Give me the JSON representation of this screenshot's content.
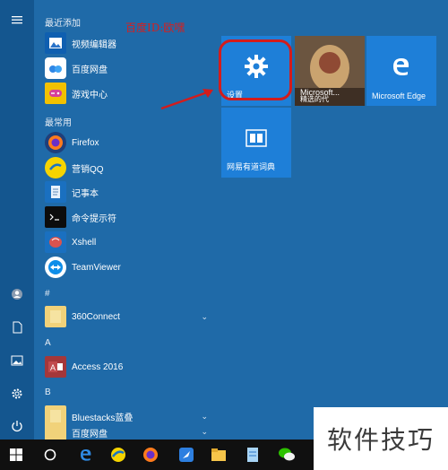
{
  "watermark_top": "百度ID:欧嘿",
  "sections": {
    "recent": "最近添加",
    "frequent": "最常用",
    "hash": "#",
    "a": "A",
    "b": "B"
  },
  "apps": {
    "video_editor": "视频编辑器",
    "baidu_disk_1": "百度网盘",
    "game_center": "游戏中心",
    "firefox": "Firefox",
    "marketing_qq": "营销QQ",
    "notepad": "记事本",
    "cmd": "命令提示符",
    "xshell": "Xshell",
    "teamviewer": "TeamViewer",
    "connect360": "360Connect",
    "access": "Access 2016",
    "bluestacks": "Bluestacks蓝叠",
    "baidu_disk_2": "百度网盘"
  },
  "tiles": {
    "settings": "设置",
    "microsoft_partial": "Microsoft...",
    "photo_overlay": "精选的代",
    "edge": "Microsoft Edge",
    "youdao": "网易有道词典"
  },
  "watermark": "软件技巧",
  "colors": {
    "bg": "#1f6aa8",
    "tile": "#1e7fd8",
    "annotation": "#d31c1c",
    "taskbar": "#101010"
  }
}
